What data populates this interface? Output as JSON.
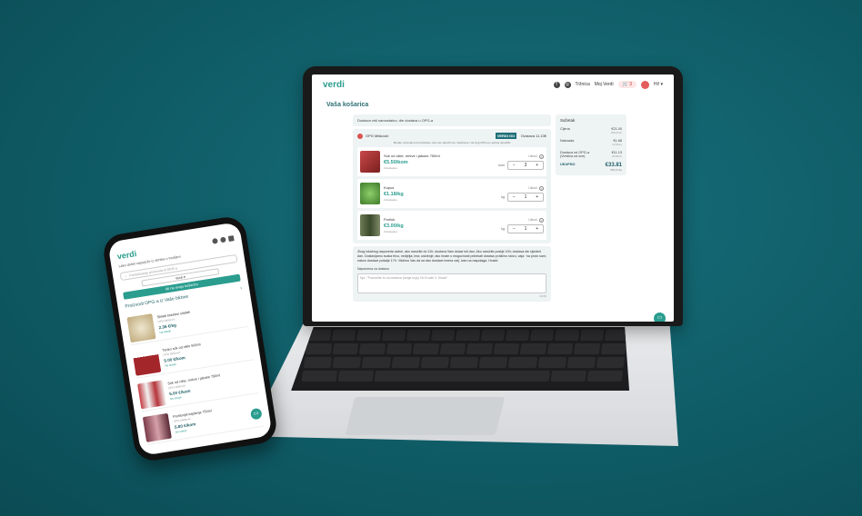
{
  "colors": {
    "brand": "#2a9d8f",
    "background": "#0f5c66",
    "accent_dark": "#1f5f66"
  },
  "laptop": {
    "logo": "verdi",
    "nav": {
      "trznica": "Tržnica",
      "moj_verdi": "Moj Verdi",
      "cart_count": "3",
      "user": "Hi! ▾"
    },
    "page_title": "Vaša košarica",
    "notice": "Dostava vrši samostalno, dle dostava u OPG-a",
    "seller": {
      "name": "OPG Mišković",
      "badge": "VERDI GO",
      "delivery": "Dostava 11.13€"
    },
    "hint": "Morate minimalnu bod dostave. Ako ste naručili sve maslinove i od sing OPG-a u jednoj narudžbi",
    "items": [
      {
        "name": "Sok od cikle, mrkve i jabuke 750ml",
        "price": "€5.50/kom",
        "farm": "3 dostupno",
        "unit": "kom",
        "qty": "3",
        "remove": "Ukloni",
        "thumb": "#b03a3a"
      },
      {
        "name": "Kupus",
        "price": "€1.18/kg",
        "farm": "2 dostupno",
        "unit": "kg",
        "qty": "1",
        "remove": "Ukloni",
        "thumb": "#4e8b3a"
      },
      {
        "name": "Poriluk",
        "price": "€3.00/kg",
        "farm": "3 dostupno",
        "unit": "kg",
        "qty": "1",
        "remove": "Ukloni",
        "thumb": "#5a6b4a"
      }
    ],
    "info_text": "Zbog lokalnog rasporeda radne, ako naručite do 11h; dostava Vam dolazi isti dan. Ako naručite poslije 10h; dostava ide sljedeći dan. Dostavljamo svaka tricu, nedjelja; ima; uskršnje; ako imate u mogućnosti pričekati dostavu pralično stoxu, vaja: 'na proto sam; nakon dostave pošalje 17h'. Molimo Vas da na dan dostave imena zalj. Ivan na raspolaga. Hvala!",
    "note_label": "Napomena za dostavu",
    "note_placeholder": "Npr. \"Pozvonite tu za dostava (dvaje koja) Od 8 sate 3. Hvala\"",
    "note_counter": "0/150",
    "summary": {
      "title": "Sažetak",
      "rows": [
        {
          "label": "Cijena",
          "value": "€21.00",
          "sub": "158.22 kn"
        },
        {
          "label": "Naknada",
          "value": "€1.68",
          "sub": "12.66 kn"
        },
        {
          "label": "Dostava od OPG-a (Verdića od sve)",
          "value": "€11.13",
          "sub": "83.86 kn"
        }
      ],
      "total_label": "UKUPNO",
      "total_value": "€33.81",
      "total_sub": "254.74 kn"
    }
  },
  "phone": {
    "logo": "verdi",
    "subtitle": "Lako dobiti najsvježe iz obrtika u trodijevi",
    "search_placeholder": "Pretraživanje proizvoda ili OPG-a",
    "select_value": "Verdi ▾",
    "cta": "Idi na svoju košaricu",
    "section_title": "Proizvodi OPG-a iz Vaše blizine",
    "items": [
      {
        "name": "Skladi krastavi sladak",
        "farm": "OPG Mišković",
        "price": "2.36 €/kg",
        "add": "Na stanje",
        "thumb": "#d8cbb0"
      },
      {
        "name": "Tanko sok od cikle 500ml",
        "farm": "OPG Mišković",
        "price": "5.00 €/kom",
        "add": "Na stanje",
        "thumb": "#a3262b"
      },
      {
        "name": "Sok od cikle, mrkve i jabuke 750ml",
        "farm": "OPG Mišković",
        "price": "5.00 €/kom",
        "add": "Na stanje",
        "thumb": "#b5343a"
      },
      {
        "name": "Prošlonjiš kajdanja 750ml",
        "farm": "OPG Mišković",
        "price": "5.80 €/kom",
        "add": "Na stanje",
        "thumb": "#7a3b4a"
      }
    ]
  }
}
